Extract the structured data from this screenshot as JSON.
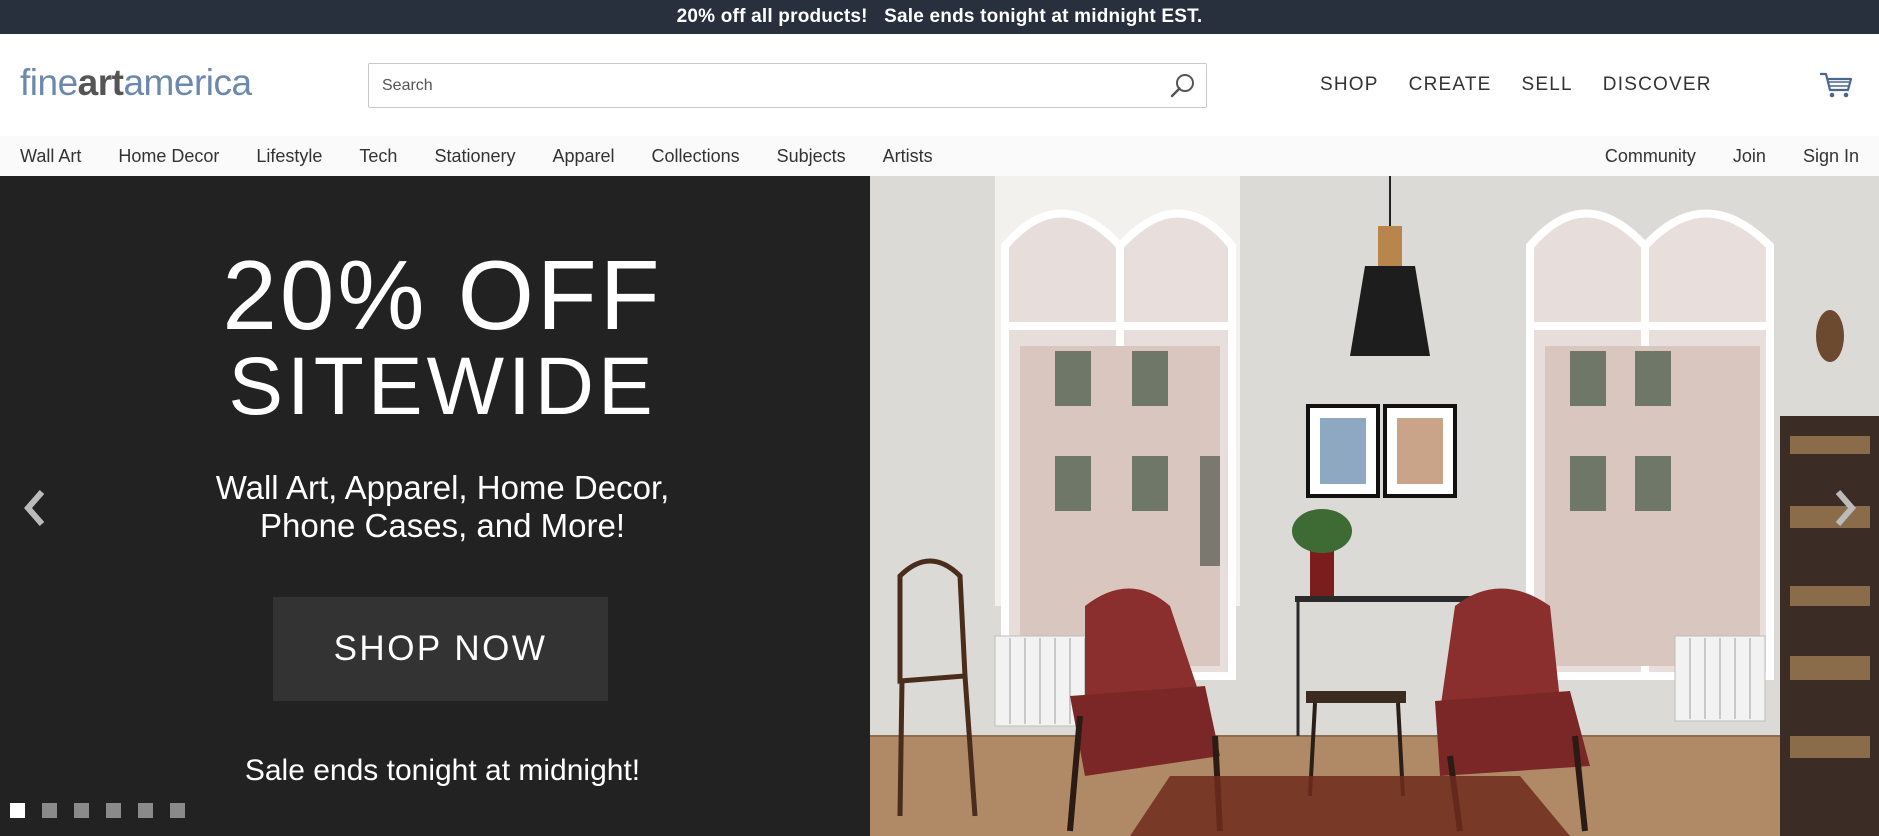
{
  "promo": {
    "text_1": "20% off all products!",
    "text_2": "Sale ends tonight at midnight EST."
  },
  "logo": {
    "part_1": "fine",
    "part_2": "art",
    "part_3": "america"
  },
  "search": {
    "placeholder": "Search",
    "value": ""
  },
  "main_nav": {
    "shop": "SHOP",
    "create": "CREATE",
    "sell": "SELL",
    "discover": "DISCOVER"
  },
  "sub_nav": {
    "items": [
      "Wall Art",
      "Home Decor",
      "Lifestyle",
      "Tech",
      "Stationery",
      "Apparel",
      "Collections",
      "Subjects",
      "Artists"
    ],
    "right": [
      "Community",
      "Join",
      "Sign In"
    ]
  },
  "hero": {
    "headline_1": "20% OFF",
    "headline_2": "SITEWIDE",
    "subhead_1": "Wall Art, Apparel, Home Decor,",
    "subhead_2": "Phone Cases, and More!",
    "button": "SHOP NOW",
    "note": "Sale ends tonight at midnight!",
    "slides": 6,
    "active_slide": 1
  },
  "colors": {
    "promo_bg": "#27303c",
    "logo_blue": "#6d88ad",
    "hero_dark": "#222222",
    "button_bg": "#333333"
  },
  "icons": [
    "search-icon",
    "cart-icon",
    "chevron-left-icon",
    "chevron-right-icon"
  ]
}
